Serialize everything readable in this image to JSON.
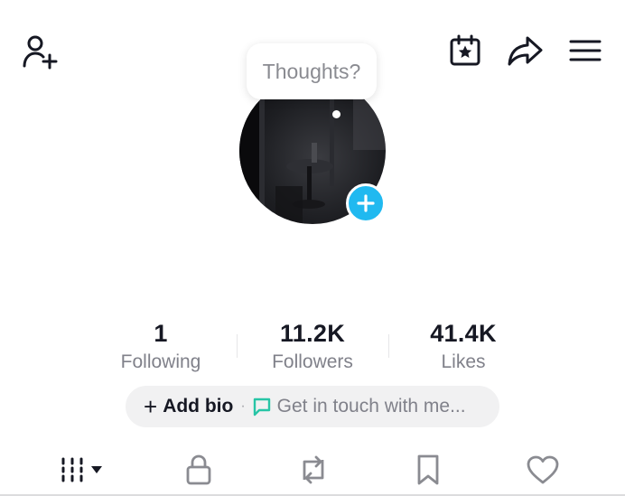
{
  "header": {
    "icons": [
      "add-user-icon",
      "calendar-star-icon",
      "share-icon",
      "menu-icon"
    ]
  },
  "bubble": {
    "text": "Thoughts?"
  },
  "avatar": {
    "add_icon": "plus-icon",
    "accent_color": "#20b9f0"
  },
  "stats": [
    {
      "value": "1",
      "label": "Following"
    },
    {
      "value": "11.2K",
      "label": "Followers"
    },
    {
      "value": "41.4K",
      "label": "Likes"
    }
  ],
  "bio": {
    "add_label": "Add bio",
    "plus": "+",
    "separator": "·",
    "contact_label": "Get in touch with me...",
    "contact_icon_color": "#27c5a6"
  },
  "tabs": [
    {
      "icon": "grid-videos-icon",
      "has_dropdown": true
    },
    {
      "icon": "lock-icon"
    },
    {
      "icon": "repost-icon"
    },
    {
      "icon": "bookmark-icon"
    },
    {
      "icon": "heart-icon"
    }
  ]
}
